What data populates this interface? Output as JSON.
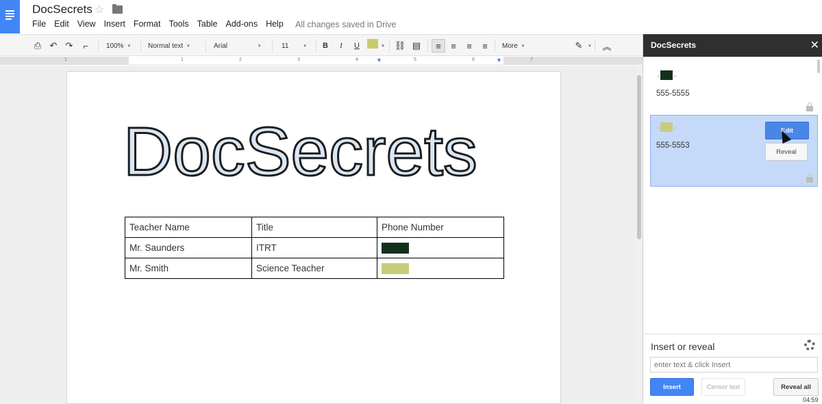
{
  "app": {
    "doc_title": "DocSecrets",
    "save_status": "All changes saved in Drive",
    "menu": [
      "File",
      "Edit",
      "View",
      "Insert",
      "Format",
      "Tools",
      "Table",
      "Add-ons",
      "Help"
    ]
  },
  "toolbar": {
    "zoom": "100%",
    "style": "Normal text",
    "font": "Arial",
    "size": "11",
    "more": "More",
    "highlight_color": "#c7cc6b"
  },
  "ruler": [
    "1",
    "1",
    "2",
    "3",
    "4",
    "5",
    "6",
    "7"
  ],
  "document": {
    "heading": "DocSecrets",
    "table": {
      "headers": [
        "Teacher Name",
        "Title",
        "Phone Number"
      ],
      "rows": [
        {
          "name": "Mr. Saunders",
          "title": "ITRT",
          "phone_color": "#15301a"
        },
        {
          "name": "Mr. Smith",
          "title": "Science Teacher",
          "phone_color": "#c6cc7a"
        }
      ]
    }
  },
  "sidebar": {
    "title": "DocSecrets",
    "cards": [
      {
        "number": "555-5555",
        "chip_color": "#15301a"
      },
      {
        "number": "555-5553",
        "chip_color": "#c6cc7a"
      }
    ],
    "edit_label": "Edit",
    "reveal_label": "Reveal",
    "insert_title": "Insert or reveal",
    "input_placeholder": "enter text & click Insert",
    "insert_label": "Insert",
    "censor_label": "Censor text",
    "reveal_all_label": "Reveal all"
  },
  "video_time": "04:59"
}
